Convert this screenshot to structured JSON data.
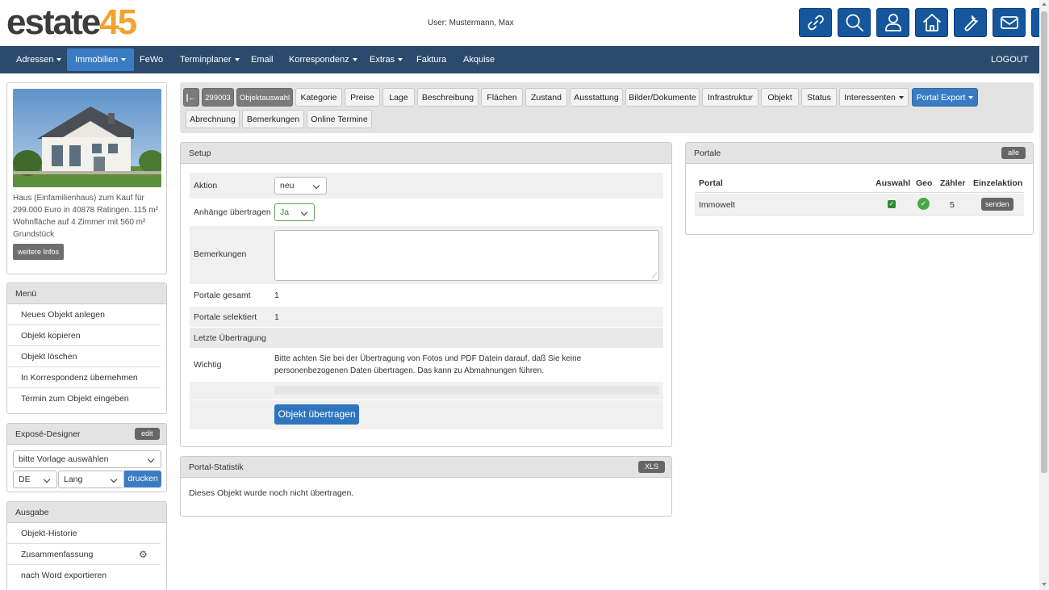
{
  "logo": {
    "part1": "estate",
    "part2": "45"
  },
  "user": "User: Mustermann, Max",
  "header_icons": [
    "link-icon",
    "search-icon",
    "user-icon",
    "home-icon",
    "wrench-icon",
    "mail-icon",
    "folder-icon"
  ],
  "nav": {
    "items": [
      "Adressen",
      "Immobilien",
      "FeWo",
      "Terminplaner",
      "Email",
      "Korrespondenz",
      "Extras",
      "Faktura",
      "Akquise"
    ],
    "logout": "LOGOUT"
  },
  "property": {
    "description": "Haus (Einfamilienhaus) zum Kauf für 299.000 Euro in 40878 Ratingen. 115 m² Wohnfläche auf 4 Zimmer mit 560 m² Grundstück",
    "button": "weitere Infos"
  },
  "menu": {
    "title": "Menü",
    "items": [
      "Neues Objekt anlegen",
      "Objekt kopieren",
      "Objekt löschen",
      "In Korrespondenz übernehmen",
      "Termin zum Objekt eingeben"
    ]
  },
  "expose": {
    "title": "Exposé-Designer",
    "edit": "edit",
    "template_select": "bitte Vorlage auswählen",
    "lang": "DE",
    "length": "Lang",
    "print": "drucken"
  },
  "ausgabe": {
    "title": "Ausgabe",
    "items": [
      "Objekt-Historie",
      "Zusammenfassung",
      "nach Word exportieren"
    ]
  },
  "tabs": {
    "object_id": "299003",
    "row1": [
      "Objektauswahl",
      "Kategorie",
      "Preise",
      "Lage",
      "Beschreibung",
      "Flächen",
      "Zustand",
      "Ausstattung",
      "Bilder/Dokumente",
      "Infrastruktur",
      "Objekt",
      "Status",
      "Interessenten",
      "Portal Export"
    ],
    "row2": [
      "Abrechnung",
      "Bemerkungen",
      "Online Termine"
    ]
  },
  "setup": {
    "title": "Setup",
    "aktion_label": "Aktion",
    "aktion_value": "neu",
    "anhaenge_label": "Anhänge übertragen",
    "anhaenge_value": "Ja",
    "bemerkungen_label": "Bemerkungen",
    "portale_gesamt_label": "Portale gesamt",
    "portale_gesamt_value": "1",
    "portale_selektiert_label": "Portale selektiert",
    "portale_selektiert_value": "1",
    "letzte_label": "Letzte Übertragung",
    "wichtig_label": "Wichtig",
    "wichtig_text": "Bitte achten Sie bei der Übertragung von Fotos und PDF Datein darauf, daß Sie keine personenbezogenen Daten übertragen. Das kann zu Abmahnungen führen.",
    "submit": "Objekt übertragen"
  },
  "statistik": {
    "title": "Portal-Statistik",
    "xls": "XLS",
    "text": "Dieses Objekt wurde noch nicht übertragen."
  },
  "portale": {
    "title": "Portale",
    "all": "alle",
    "columns": [
      "Portal",
      "Auswahl",
      "Geo",
      "Zähler",
      "Einzelaktion"
    ],
    "rows": [
      {
        "portal": "Immowelt",
        "zaehler": "5",
        "action": "senden"
      }
    ]
  }
}
